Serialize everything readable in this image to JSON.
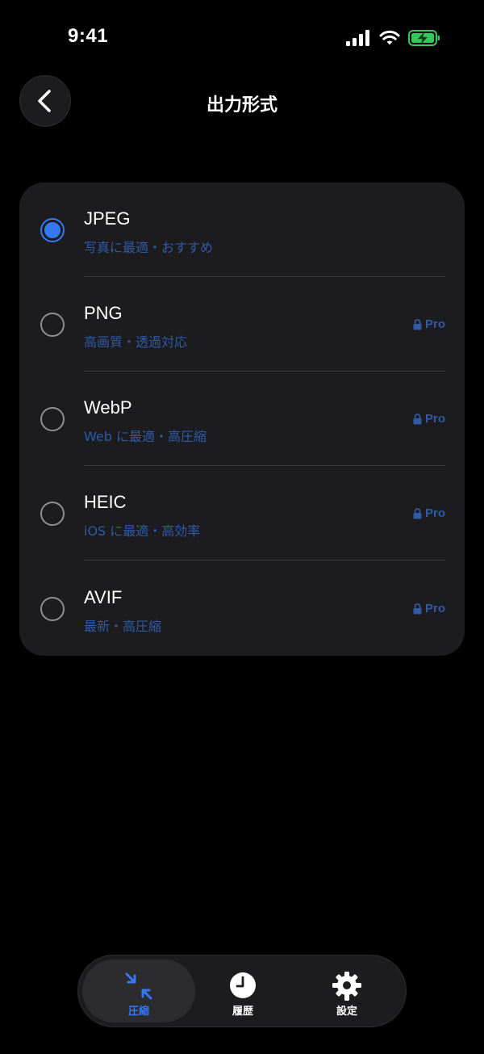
{
  "status_bar": {
    "time": "9:41"
  },
  "header": {
    "title": "出力形式",
    "back_icon": "chevron-left-icon"
  },
  "formats": [
    {
      "name": "JPEG",
      "description": "写真に最適・おすすめ",
      "selected": true,
      "pro": false
    },
    {
      "name": "PNG",
      "description": "高画質・透過対応",
      "selected": false,
      "pro": true,
      "pro_label": "Pro"
    },
    {
      "name": "WebP",
      "description": "Web に最適・高圧縮",
      "selected": false,
      "pro": true,
      "pro_label": "Pro"
    },
    {
      "name": "HEIC",
      "description": "iOS に最適・高効率",
      "selected": false,
      "pro": true,
      "pro_label": "Pro"
    },
    {
      "name": "AVIF",
      "description": "最新・高圧縮",
      "selected": false,
      "pro": true,
      "pro_label": "Pro"
    }
  ],
  "tab_bar": {
    "tabs": [
      {
        "label": "圧縮",
        "icon": "compress-arrows-icon",
        "active": true
      },
      {
        "label": "履歴",
        "icon": "clock-icon",
        "active": false
      },
      {
        "label": "設定",
        "icon": "gear-icon",
        "active": false
      }
    ]
  },
  "colors": {
    "background": "#000000",
    "card": "#1c1c1e",
    "accent": "#3478f6",
    "secondary_text": "#2f5aa8",
    "battery": "#34c759"
  }
}
